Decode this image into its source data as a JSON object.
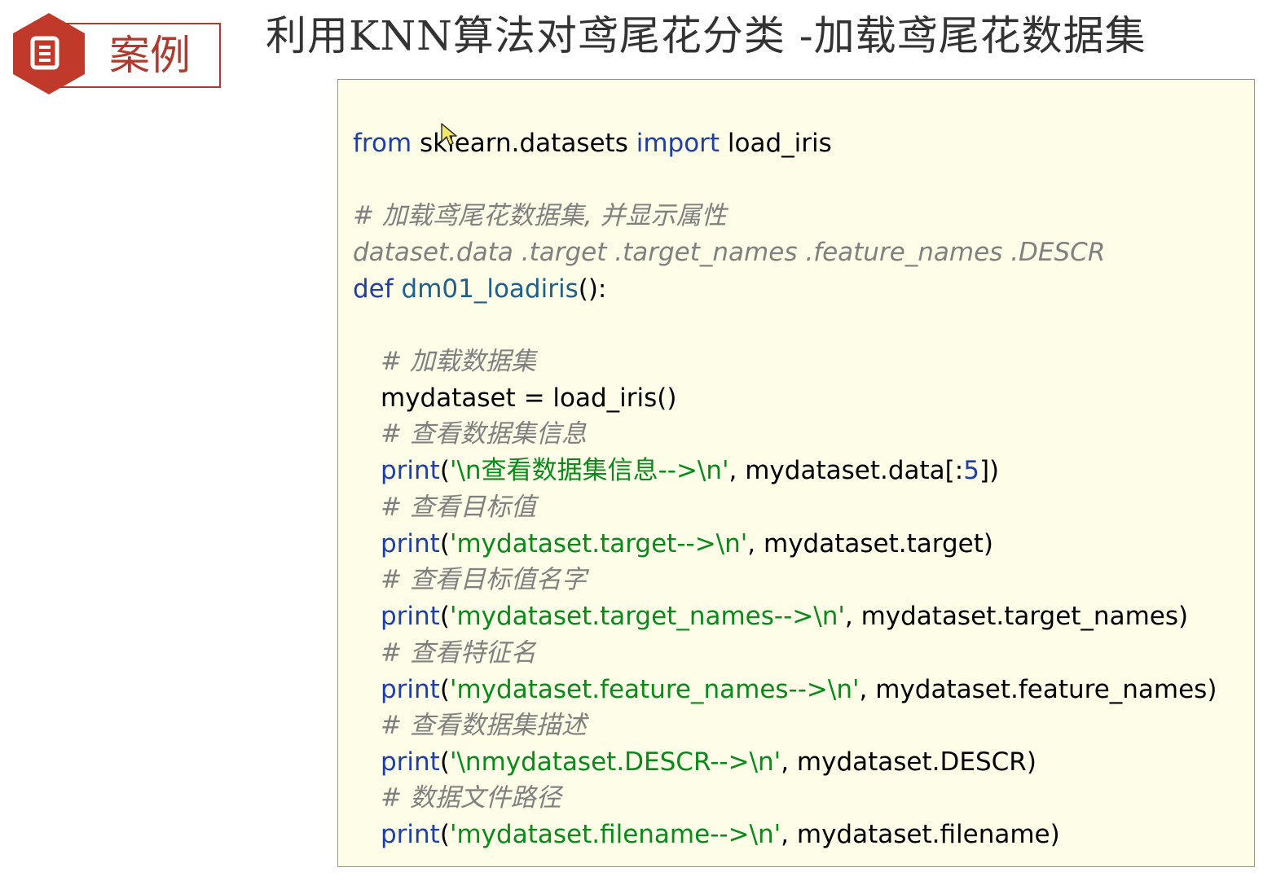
{
  "badge": {
    "label": "案例",
    "icon": "document-icon",
    "color": "#c0392b"
  },
  "title": "利用KNN算法对鸢尾花分类 -加载鸢尾花数据集",
  "code": {
    "l1": {
      "a": "from",
      "b": " sklearn.datasets ",
      "c": "import",
      "d": " load_iris"
    },
    "c1": "# 加载鸢尾花数据集, 并显示属性",
    "c2": "dataset.data .target .target_names .feature_names .DESCR",
    "l2": {
      "a": "def",
      "b": " dm01_loadiris",
      "c": "():"
    },
    "c3": "# 加载数据集",
    "l3": "mydataset = load_iris()",
    "c4": "# 查看数据集信息",
    "p1": {
      "fn": "print",
      "open": "(",
      "str": "'\\n查看数据集信息-->\\n'",
      "rest1": ", mydataset.data[:",
      "num": "5",
      "rest2": "])"
    },
    "c5": "# 查看目标值",
    "p2": {
      "fn": "print",
      "open": "(",
      "str": "'mydataset.target-->\\n'",
      "rest": ", mydataset.target)"
    },
    "c6": "# 查看目标值名字",
    "p3": {
      "fn": "print",
      "open": "(",
      "str": "'mydataset.target_names-->\\n'",
      "rest": ", mydataset.target_names)"
    },
    "c7": "# 查看特征名",
    "p4": {
      "fn": "print",
      "open": "(",
      "str": "'mydataset.feature_names-->\\n'",
      "rest": ", mydataset.feature_names)"
    },
    "c8": "# 查看数据集描述",
    "p5": {
      "fn": "print",
      "open": "(",
      "str": "'\\nmydataset.DESCR-->\\n'",
      "rest": ", mydataset.DESCR)"
    },
    "c9": "# 数据文件路径",
    "p6": {
      "fn": "print",
      "open": "(",
      "str": "'mydataset.filename-->\\n'",
      "rest": ", mydataset.filename)"
    }
  },
  "colors": {
    "keyword": "#1f3ea8",
    "string": "#0a8a1a",
    "comment": "#808080",
    "code_background": "#fdfde8"
  }
}
